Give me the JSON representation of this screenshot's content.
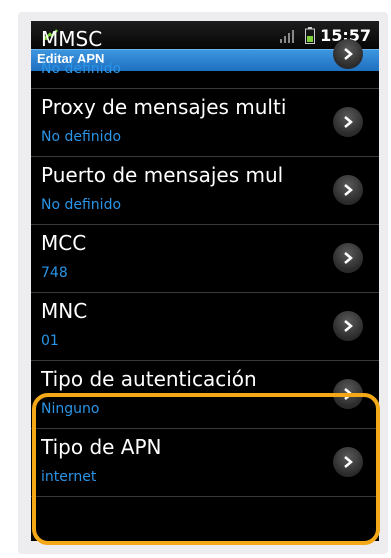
{
  "status_bar": {
    "time": "15:57"
  },
  "title_bar": {
    "title": "Editar APN"
  },
  "settings": [
    {
      "title": "MMSC",
      "value": "No definido"
    },
    {
      "title": "Proxy de mensajes multi",
      "value": "No definido"
    },
    {
      "title": "Puerto de mensajes mul",
      "value": "No definido"
    },
    {
      "title": "MCC",
      "value": "748"
    },
    {
      "title": "MNC",
      "value": "01"
    },
    {
      "title": "Tipo de autenticación",
      "value": "Ninguno"
    },
    {
      "title": "Tipo de APN",
      "value": "internet"
    }
  ],
  "colors": {
    "accent": "#2a94e6",
    "highlight": "#f3a818",
    "title_bar": "#1e6fc0"
  }
}
